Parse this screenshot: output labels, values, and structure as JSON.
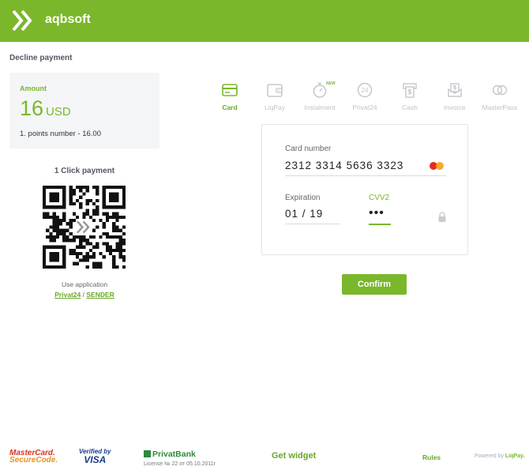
{
  "header": {
    "brand": "aqbsoft"
  },
  "page_title": "Decline payment",
  "amount": {
    "label": "Amount",
    "value": "16",
    "currency": "USD",
    "description": "1. points number - 16.00"
  },
  "one_click": {
    "title": "1 Click payment",
    "use_app": "Use application",
    "link_privat": "Privat24",
    "separator": " / ",
    "link_sender": "SENDER"
  },
  "tabs": [
    {
      "label": "Card",
      "active": true,
      "icon": "card-icon"
    },
    {
      "label": "LiqPay",
      "icon": "wallet-icon"
    },
    {
      "label": "Instalment",
      "icon": "stopwatch-icon",
      "badge": "NEW"
    },
    {
      "label": "Privat24",
      "icon": "privat24-icon",
      "icon_text": "24"
    },
    {
      "label": "Cash",
      "icon": "cash-icon"
    },
    {
      "label": "Invoice",
      "icon": "invoice-icon"
    },
    {
      "label": "MasterPass",
      "icon": "masterpass-icon"
    }
  ],
  "card_form": {
    "card_number_label": "Card number",
    "card_number": "2312 3314 5636 3323",
    "expiration_label": "Expiration",
    "expiration": "01 / 19",
    "cvv_label": "CVV2",
    "cvv": "•••"
  },
  "confirm_label": "Confirm",
  "footer": {
    "mastercard_l1": "MasterCard.",
    "mastercard_l2": "SecureCode.",
    "visa_l1": "Verified by",
    "visa_l2": "VISA",
    "privatbank_name": "PrivatBank",
    "privatbank_license": "License № 22 от 05.10.2011г",
    "widget": "Get widget",
    "rules": "Rules",
    "powered_prefix": "Powered by ",
    "powered_brand": "LiqPay."
  },
  "colors": {
    "brand_green": "#7ab72b",
    "link_green": "#6aa726",
    "inactive": "#bfc3c8"
  }
}
